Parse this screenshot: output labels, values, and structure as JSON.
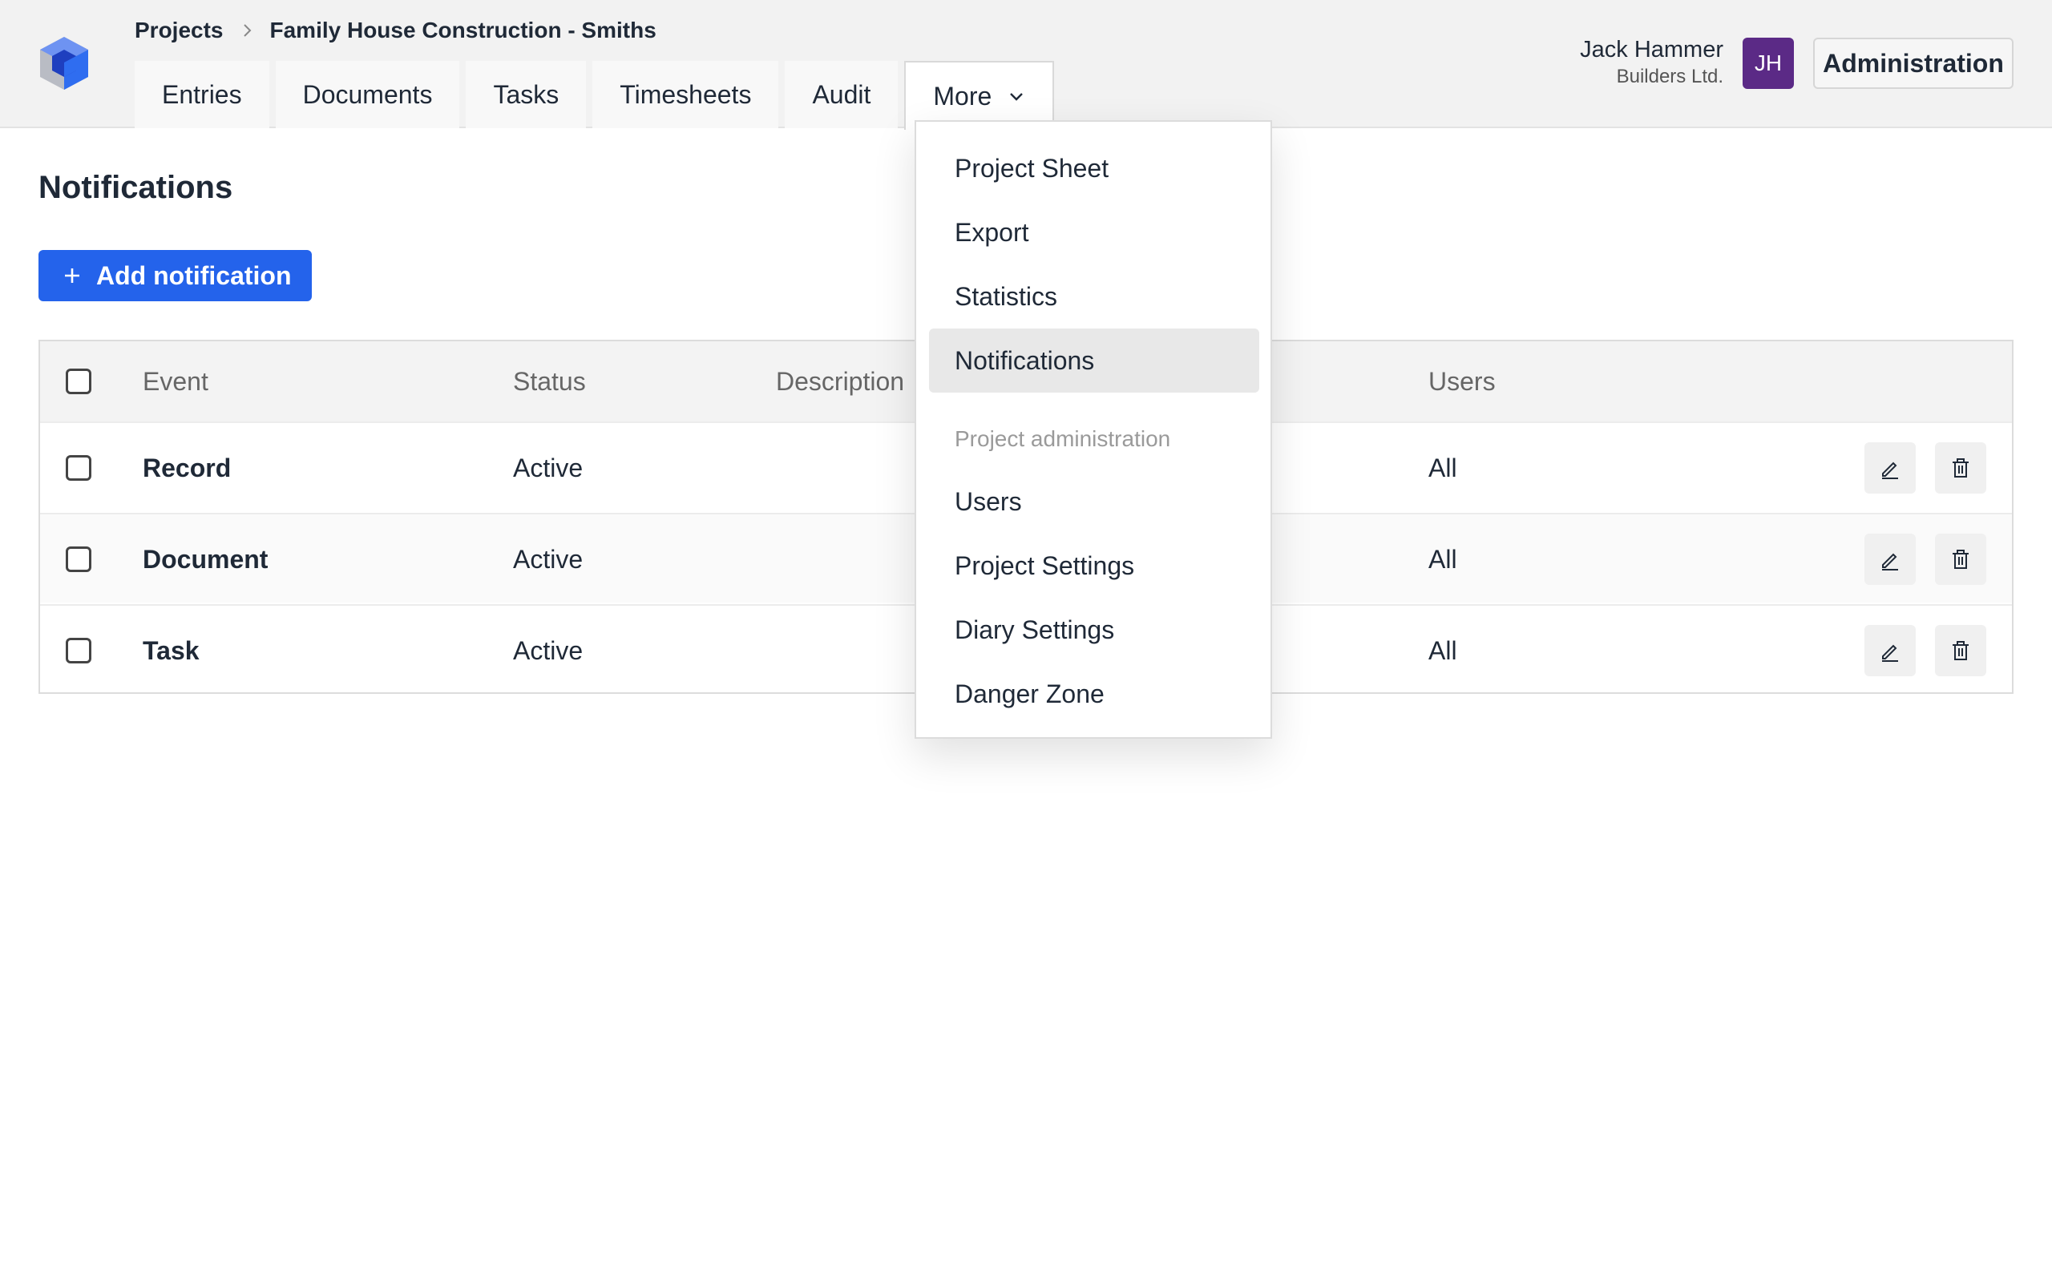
{
  "breadcrumb": {
    "root": "Projects",
    "current": "Family House Construction - Smiths"
  },
  "tabs": [
    {
      "label": "Entries"
    },
    {
      "label": "Documents"
    },
    {
      "label": "Tasks"
    },
    {
      "label": "Timesheets"
    },
    {
      "label": "Audit"
    },
    {
      "label": "More"
    }
  ],
  "user": {
    "name": "Jack Hammer",
    "company": "Builders Ltd.",
    "initials": "JH",
    "avatar_color": "#5b2a86"
  },
  "header": {
    "admin_label": "Administration"
  },
  "page": {
    "title": "Notifications",
    "add_label": "Add notification"
  },
  "table": {
    "columns": [
      "Event",
      "Status",
      "Description",
      "Users"
    ],
    "rows": [
      {
        "event": "Record",
        "status": "Active",
        "users": "All"
      },
      {
        "event": "Document",
        "status": "Active",
        "users": "All"
      },
      {
        "event": "Task",
        "status": "Active",
        "users": "All"
      }
    ]
  },
  "more_menu": {
    "items": [
      {
        "label": "Project Sheet"
      },
      {
        "label": "Export"
      },
      {
        "label": "Statistics"
      },
      {
        "label": "Notifications",
        "active": true
      }
    ],
    "section_label": "Project administration",
    "admin_items": [
      {
        "label": "Users"
      },
      {
        "label": "Project Settings"
      },
      {
        "label": "Diary Settings"
      },
      {
        "label": "Danger Zone"
      }
    ]
  },
  "colors": {
    "primary": "#2463eb",
    "logo_blue": "#2f6df0",
    "logo_dark": "#1e3fbf",
    "logo_grey": "#b9bcc4"
  },
  "icons": {
    "logo": "cube-logo-icon",
    "separator": "chevron-right-icon",
    "more": "chevron-down-icon",
    "add": "plus-icon",
    "edit": "pencil-icon",
    "delete": "trash-icon"
  }
}
